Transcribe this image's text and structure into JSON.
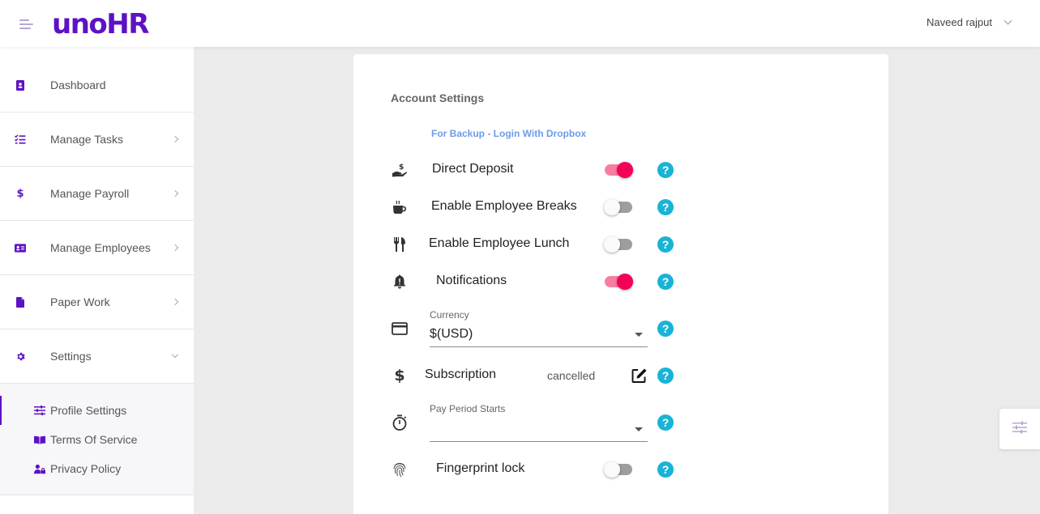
{
  "app": {
    "logo": "unoHR"
  },
  "header": {
    "user_name": "Naveed rajput"
  },
  "sidebar": {
    "items": [
      {
        "label": "Dashboard",
        "icon": "contact-book-icon"
      },
      {
        "label": "Manage Tasks",
        "icon": "checklist-icon"
      },
      {
        "label": "Manage Payroll",
        "icon": "dollar-icon"
      },
      {
        "label": "Manage Employees",
        "icon": "id-card-icon"
      },
      {
        "label": "Paper Work",
        "icon": "document-icon"
      },
      {
        "label": "Settings",
        "icon": "gear-icon"
      }
    ],
    "settings_sub": [
      {
        "label": "Profile Settings",
        "icon": "sliders-icon"
      },
      {
        "label": "Terms Of Service",
        "icon": "book-icon"
      },
      {
        "label": "Privacy Policy",
        "icon": "user-lock-icon"
      }
    ]
  },
  "settings": {
    "title": "Account Settings",
    "dropbox_link": "For Backup - Login With Dropbox",
    "direct_deposit": {
      "label": "Direct Deposit",
      "on": true
    },
    "employee_breaks": {
      "label": "Enable Employee Breaks",
      "on": false
    },
    "employee_lunch": {
      "label": "Enable Employee Lunch",
      "on": false
    },
    "notifications": {
      "label": "Notifications",
      "on": true
    },
    "currency": {
      "label": "Currency",
      "value": "$(USD)"
    },
    "subscription": {
      "label": "Subscription",
      "status": "cancelled"
    },
    "pay_period": {
      "label": "Pay Period Starts",
      "value": ""
    },
    "fingerprint": {
      "label": "Fingerprint lock",
      "on": false
    },
    "help_glyph": "?"
  },
  "colors": {
    "brand": "#5d12c4",
    "toggle_on": "#f50057",
    "help": "#1ab3d6",
    "link": "#6f9be5"
  }
}
